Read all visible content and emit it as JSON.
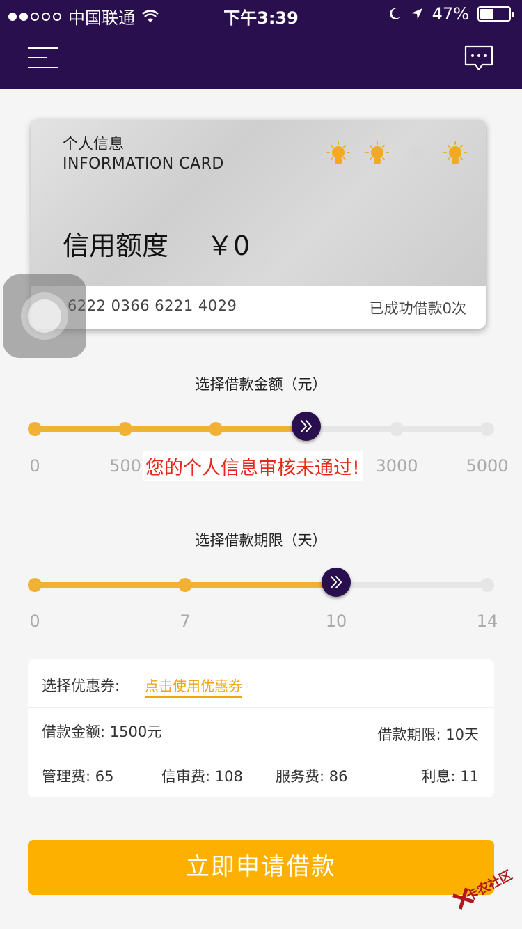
{
  "status_bar": {
    "carrier": "中国联通",
    "time": "下午3:39",
    "battery": "47%",
    "battery_level": 0.47
  },
  "nav": {
    "menu_icon": "hamburger-menu-icon",
    "message_icon": "chat-bubble-icon"
  },
  "card": {
    "title_cn": "个人信息",
    "title_en": "INFORMATION CARD",
    "credit_label": "信用额度",
    "credit_value": "￥0",
    "card_number": "6222 0366 6221 4029",
    "borrow_count": "已成功借款0次",
    "bulbs": [
      {
        "state": "lit",
        "color": "#f4a923"
      },
      {
        "state": "lit",
        "color": "#f4a923"
      },
      {
        "state": "unlit",
        "color": "#d7d7d7"
      },
      {
        "state": "lit",
        "color": "#f4a923"
      }
    ]
  },
  "amount_slider": {
    "title": "选择借款金额（元）",
    "ticks": [
      "0",
      "500",
      "3000",
      "5000"
    ],
    "error": "您的个人信息审核未通过!",
    "accent": "#f0b135",
    "thumb_color": "#2a0f4f"
  },
  "term_slider": {
    "title": "选择借款期限（天）",
    "ticks": [
      "0",
      "7",
      "10",
      "14"
    ]
  },
  "summary": {
    "coupon_label": "选择优惠券:",
    "coupon_link": "点击使用优惠券",
    "amount": "借款金额: 1500元",
    "term": "借款期限: 10天",
    "management_fee": "管理费: 65",
    "review_fee": "信审费: 108",
    "service_fee": "服务费: 86",
    "interest": "利息: 11"
  },
  "apply_button": "立即申请借款",
  "watermark": "卡农社区"
}
